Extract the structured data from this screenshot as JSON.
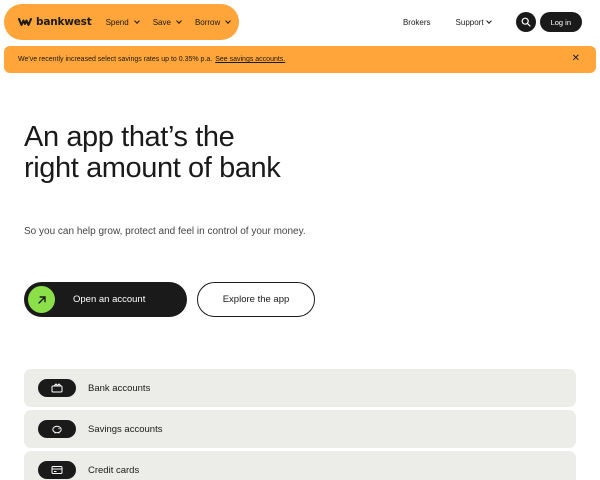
{
  "brand": {
    "name": "bankwest"
  },
  "nav": {
    "items": [
      {
        "label": "Spend"
      },
      {
        "label": "Save"
      },
      {
        "label": "Borrow"
      }
    ],
    "brokers_label": "Brokers",
    "support_label": "Support",
    "login_label": "Log in"
  },
  "banner": {
    "text": "We've recently increased select savings rates up to 0.35% p.a.",
    "link_label": "See savings accounts."
  },
  "hero": {
    "title": "An app that’s the right amount of bank",
    "subtitle": "So you can help grow, protect and feel in control of your money.",
    "primary_button": "Open an account",
    "secondary_button": "Explore the app"
  },
  "products": [
    {
      "label": "Bank accounts",
      "icon": "wallet-icon"
    },
    {
      "label": "Savings accounts",
      "icon": "piggy-bank-icon"
    },
    {
      "label": "Credit cards",
      "icon": "credit-card-icon"
    }
  ],
  "colors": {
    "accent": "#ffa53a",
    "cta_arrow": "#8be04a",
    "dark": "#1a1a1a",
    "row_bg": "#ecede9"
  }
}
